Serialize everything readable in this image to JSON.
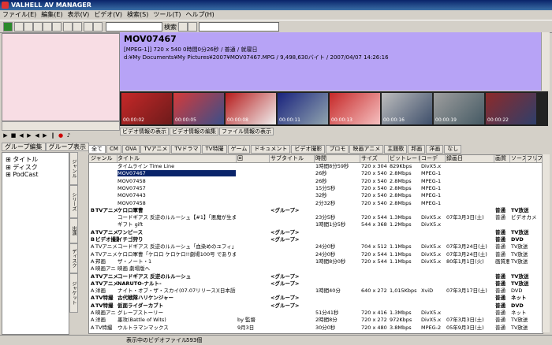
{
  "app": {
    "title": "VALHELL AV MANAGER"
  },
  "menu": [
    "ファイル(E)",
    "編集(E)",
    "表示(V)",
    "ビデオ(V)",
    "検索(S)",
    "ツール(T)",
    "ヘルプ(H)"
  ],
  "toolbar": {
    "search_label": "検索"
  },
  "left": {
    "tabs": [
      "グループ編集",
      "グループ表示"
    ],
    "tree": [
      "タイトル",
      "ディスク",
      "PodCast"
    ],
    "vtabs": [
      "ジャンル",
      "シリーズ",
      "出演",
      "ディスク",
      "ジャケット"
    ]
  },
  "video": {
    "title": "MOV07467",
    "meta": "[MPEG-1]] 720 x 540 0時間0分26秒  / 普通 / 就寝日",
    "path": "d:¥My Documents¥My Pictures¥2007¥MOV07467.MPG / 9,498,630バイト / 2007/04/07 14:26:16",
    "thumb_times": [
      "00:00:02",
      "00:00:05",
      "00:00:08",
      "00:00:11",
      "00:00:13",
      "00:00:16",
      "00:00:19",
      "00:00:22"
    ]
  },
  "info_tabs": [
    "ビデオ情報の表示",
    "ビデオ情報の編集",
    "ファイル情報の表示"
  ],
  "genre_tabs": [
    "全て",
    "CM",
    "OVA",
    "TVアニメ",
    "TVドラマ",
    "TV特撮",
    "ゲーム",
    "ドキュメント",
    "ビデオ撮影",
    "プロモ",
    "映画アニメ",
    "主題歌",
    "邦画",
    "洋画",
    "なし"
  ],
  "columns": [
    "ジャンル",
    "タイトル",
    "回",
    "サブタイトル",
    "時間",
    "サイズ",
    "ビットレート",
    "コーデ",
    "録画日",
    "画質",
    "ソース",
    "フリー1",
    "フリー"
  ],
  "rows": [
    {
      "mark": "",
      "genre": "",
      "title": "タイムライン Time Line",
      "ep": "",
      "sub": "",
      "time": "1時間8分59秒",
      "size": "720 x 304",
      "rate": "829Kbps",
      "codec": "DivX5.x",
      "date": "",
      "q": "",
      "src": ""
    },
    {
      "mark": "",
      "genre": "",
      "title": "MOV07467",
      "ep": "",
      "sub": "",
      "time": "26秒",
      "size": "720 x 540",
      "rate": "2.8Mbps",
      "codec": "MPEG-1",
      "date": "",
      "q": "",
      "src": "",
      "sel": true
    },
    {
      "mark": "",
      "genre": "",
      "title": "MOV07458",
      "ep": "",
      "sub": "",
      "time": "26秒",
      "size": "720 x 540",
      "rate": "2.8Mbps",
      "codec": "MPEG-1",
      "date": "",
      "q": "",
      "src": ""
    },
    {
      "mark": "",
      "genre": "",
      "title": "MOV07457",
      "ep": "",
      "sub": "",
      "time": "15分5秒",
      "size": "720 x 540",
      "rate": "2.8Mbps",
      "codec": "MPEG-1",
      "date": "",
      "q": "",
      "src": ""
    },
    {
      "mark": "",
      "genre": "",
      "title": "MOV07443",
      "ep": "",
      "sub": "",
      "time": "32秒",
      "size": "720 x 540",
      "rate": "2.8Mbps",
      "codec": "MPEG-1",
      "date": "",
      "q": "",
      "src": ""
    },
    {
      "mark": "",
      "genre": "",
      "title": "MOV07458",
      "ep": "",
      "sub": "",
      "time": "2分32秒",
      "size": "720 x 540",
      "rate": "2.8Mbps",
      "codec": "MPEG-1",
      "date": "",
      "q": "",
      "src": ""
    },
    {
      "mark": "B",
      "genre": "TVアニメ",
      "title": "ケロロ軍曹",
      "ep": "",
      "sub": "<グループ>",
      "time": "",
      "size": "",
      "rate": "",
      "codec": "",
      "date": "",
      "q": "普通",
      "src": "TV放送",
      "grp": true
    },
    {
      "mark": "",
      "genre": "",
      "title": "コードギアス 反逆のルルーシュ【#1】「悪魔が生まれた日」",
      "ep": "",
      "sub": "",
      "time": "23分5秒",
      "size": "720 x 544",
      "rate": "1.3Mbps",
      "codec": "DivX5.x",
      "date": "07年3月3日(土)",
      "q": "普通",
      "src": "ビデオカメ"
    },
    {
      "mark": "",
      "genre": "",
      "title": "ギフト gift",
      "ep": "",
      "sub": "",
      "time": "1時間1分5秒",
      "size": "544 x 368",
      "rate": "1.2Mbps",
      "codec": "DivX5.x",
      "date": "",
      "q": "",
      "src": ""
    },
    {
      "mark": "A",
      "genre": "TVアニメ",
      "title": "ワンピース",
      "ep": "",
      "sub": "<グループ>",
      "time": "",
      "size": "",
      "rate": "",
      "codec": "",
      "date": "",
      "q": "普通",
      "src": "TV放送",
      "grp": true
    },
    {
      "mark": "B",
      "genre": "ビデオ撮影",
      "title": "イチゴ狩り",
      "ep": "",
      "sub": "<グループ>",
      "time": "",
      "size": "",
      "rate": "",
      "codec": "",
      "date": "",
      "q": "普通",
      "src": "DVD",
      "grp": true
    },
    {
      "mark": "A",
      "genre": "TVアニメ",
      "title": "コードギアス 反逆のルルーシュ「血染めのユフィ」3月24日",
      "ep": "",
      "sub": "",
      "time": "24分0秒",
      "size": "704 x 512",
      "rate": "1.1Mbps",
      "codec": "DivX5.x",
      "date": "07年3月24日(土)",
      "q": "普通",
      "src": "TV放送"
    },
    {
      "mark": "A",
      "genre": "TVアニメ",
      "title": "ケロロ軍曹「ケロロ ケロケロ!!劇場100号 であります」3",
      "ep": "",
      "sub": "",
      "time": "24分0秒",
      "size": "720 x 544",
      "rate": "1.1Mbps",
      "codec": "DivX5.x",
      "date": "07年3月24日(土)",
      "q": "普通",
      "src": "TV放送"
    },
    {
      "mark": "A",
      "genre": "邦画",
      "title": "ザ・ノート・1",
      "ep": "",
      "sub": "",
      "time": "1時間8分0秒",
      "size": "720 x 544",
      "rate": "1.1Mbps",
      "codec": "DivX5.x",
      "date": "80年1月1日(火)",
      "q": "画質悪",
      "src": "TV放送"
    },
    {
      "mark": "A",
      "genre": "映画アニ",
      "title": "映画 劇場版へ",
      "ep": "",
      "sub": "",
      "time": "",
      "size": "",
      "rate": "",
      "codec": "",
      "date": "",
      "q": "",
      "src": ""
    },
    {
      "mark": "A",
      "genre": "TVアニメ",
      "title": "コードギアス 反逆のルルーシュ",
      "ep": "",
      "sub": "<グループ>",
      "time": "",
      "size": "",
      "rate": "",
      "codec": "",
      "date": "",
      "q": "普通",
      "src": "TV放送",
      "grp": true
    },
    {
      "mark": "A",
      "genre": "TVアニメ",
      "title": "NARUTO-ナルト-",
      "ep": "",
      "sub": "<グループ>",
      "time": "",
      "size": "",
      "rate": "",
      "codec": "",
      "date": "",
      "q": "普通",
      "src": "TV放送",
      "grp": true
    },
    {
      "mark": "A",
      "genre": "洋画",
      "title": "ナイト・オブ・ザ・スカイ(07.07リリース)(日本語字幕)DVDRip",
      "ep": "",
      "sub": "",
      "time": "1時間40分",
      "size": "640 x 272",
      "rate": "1,015Kbps",
      "codec": "XviD",
      "date": "07年3月17日(土)",
      "q": "普通",
      "src": "DVD"
    },
    {
      "mark": "A",
      "genre": "TV特撮",
      "title": "古代戦隊ハリケンジャー",
      "ep": "",
      "sub": "<グループ>",
      "time": "",
      "size": "",
      "rate": "",
      "codec": "",
      "date": "",
      "q": "普通",
      "src": "ネット",
      "grp": true
    },
    {
      "mark": "A",
      "genre": "TV特撮",
      "title": "仮面ライダーカブト",
      "ep": "",
      "sub": "<グループ>",
      "time": "",
      "size": "",
      "rate": "",
      "codec": "",
      "date": "",
      "q": "普通",
      "src": "DVD",
      "grp": true
    },
    {
      "mark": "A",
      "genre": "映画アニ",
      "title": "グレープストーリー",
      "ep": "",
      "sub": "",
      "time": "51分41秒",
      "size": "720 x 416",
      "rate": "1.3Mbps",
      "codec": "DivX5.x",
      "date": "",
      "q": "普通",
      "src": "ネット"
    },
    {
      "mark": "A",
      "genre": "洋画",
      "title": "墨攻(Battle of Wits)",
      "ep": "by 監督",
      "sub": "",
      "time": "2時間8分",
      "size": "720 x 272",
      "rate": "972Kbps",
      "codec": "DivX5.x",
      "date": "07年3月3日(土)",
      "q": "普通",
      "src": "TV放送"
    },
    {
      "mark": "A",
      "genre": "TV特撮",
      "title": "ウルトラマンマックス",
      "ep": "9月3日",
      "sub": "",
      "time": "30分0秒",
      "size": "720 x 480",
      "rate": "3.8Mbps",
      "codec": "MPEG-2",
      "date": "05年9月3日(土)",
      "q": "普通",
      "src": "TV放送"
    }
  ],
  "status": {
    "label": "表示中のビデオファイル",
    "count": "593個"
  }
}
